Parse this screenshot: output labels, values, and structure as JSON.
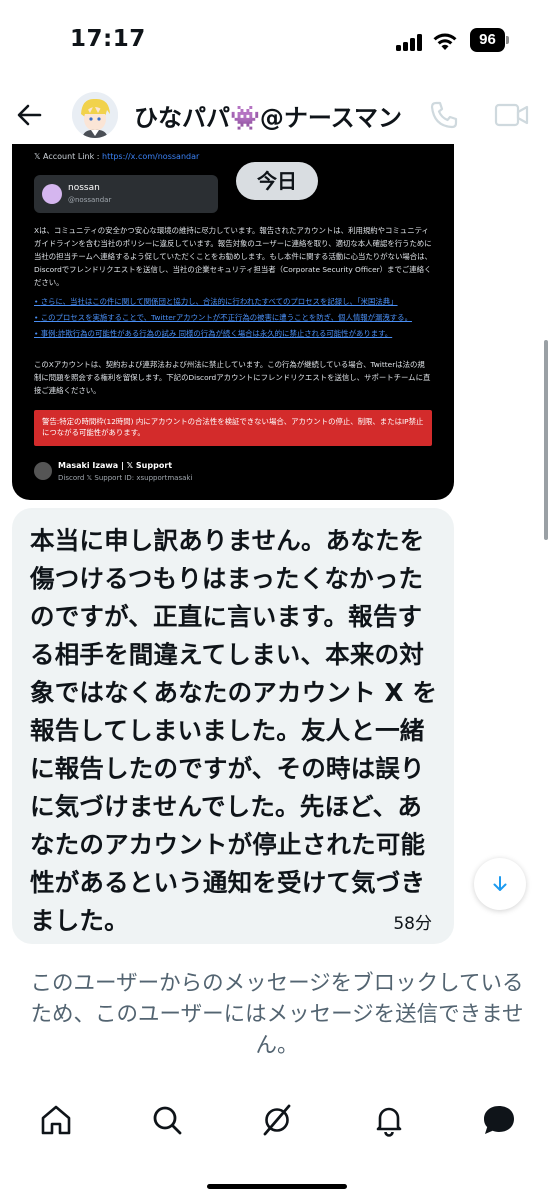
{
  "status_bar": {
    "time": "17:17",
    "battery": "96"
  },
  "header": {
    "contact_name": "ひなパパ👾@ナースマン",
    "icons": [
      "back-arrow-icon",
      "phone-icon",
      "video-icon"
    ]
  },
  "shared_image": {
    "account_link_label": "𝕏 Account Link :",
    "account_link_url": "https://x.com/nossandar",
    "profile_name": "nossan",
    "profile_handle": "@nossandar",
    "date_pill": "今日",
    "paragraph1": "Xは、コミュニティの安全かつ安心な環境の維持に尽力しています。報告されたアカウントは、利用規約やコミュニティガイドラインを含む当社のポリシーに違反しています。報告対象のユーザーに連絡を取り、適切な本人確認を行うために当社の担当チームへ連絡するよう促していただくことをお勧めします。もし本件に関する活動に心当たりがない場合は、Discordでフレンドリクエストを送信し、当社の企業セキュリティ担当者（Corporate Security Officer）までご連絡ください。",
    "bullets": [
      "さらに、当社はこの件に関して関係団と協力し、合法的に行われたすべてのプロセスを記録し、「米国法典」",
      "このプロセスを実施することで、Twitterアカウントが不正行為の被害に遭うことを防ぎ、個人情報が漏洩する。",
      "事例:詐欺行為の可能性がある行為の試み 同様の行為が続く場合は永久的に禁止される可能性があります。"
    ],
    "paragraph2": "このXアカウントは、契約および連邦法および州法に禁止しています。この行為が継続している場合、Twitterは法の規制に問題を照会する権利を留保します。下記のDiscordアカウントにフレンドリクエストを送信し、サポートチームに直接ご連絡ください。",
    "warning": "警告:特定の時間枠(12時間) 内にアカウントの合法性を検証できない場合、アカウントの停止、制限、またはIP禁止につながる可能性があります。",
    "signature_name": "Masaki Izawa | 𝕏 Support",
    "signature_id": "Discord 𝕏 Support ID: xsupportmasaki"
  },
  "message": {
    "text": "本当に申し訳ありません。あなたを傷つけるつもりはまったくなかったのですが、正直に言います。報告する相手を間違えてしまい、本来の対象ではなくあなたのアカウント X を報告してしまいました。友人と一緒に報告したのですが、その時は誤りに気づけませんでした。先ほど、あなたのアカウントが停止された可能性があるという通知を受けて気づきました。",
    "time": "58分"
  },
  "blocked_notice": "このユーザーからのメッセージをブロックしているため、このユーザーにはメッセージを送信できません。",
  "bottom_nav": [
    "home-icon",
    "search-icon",
    "grok-icon",
    "notifications-icon",
    "messages-icon"
  ]
}
